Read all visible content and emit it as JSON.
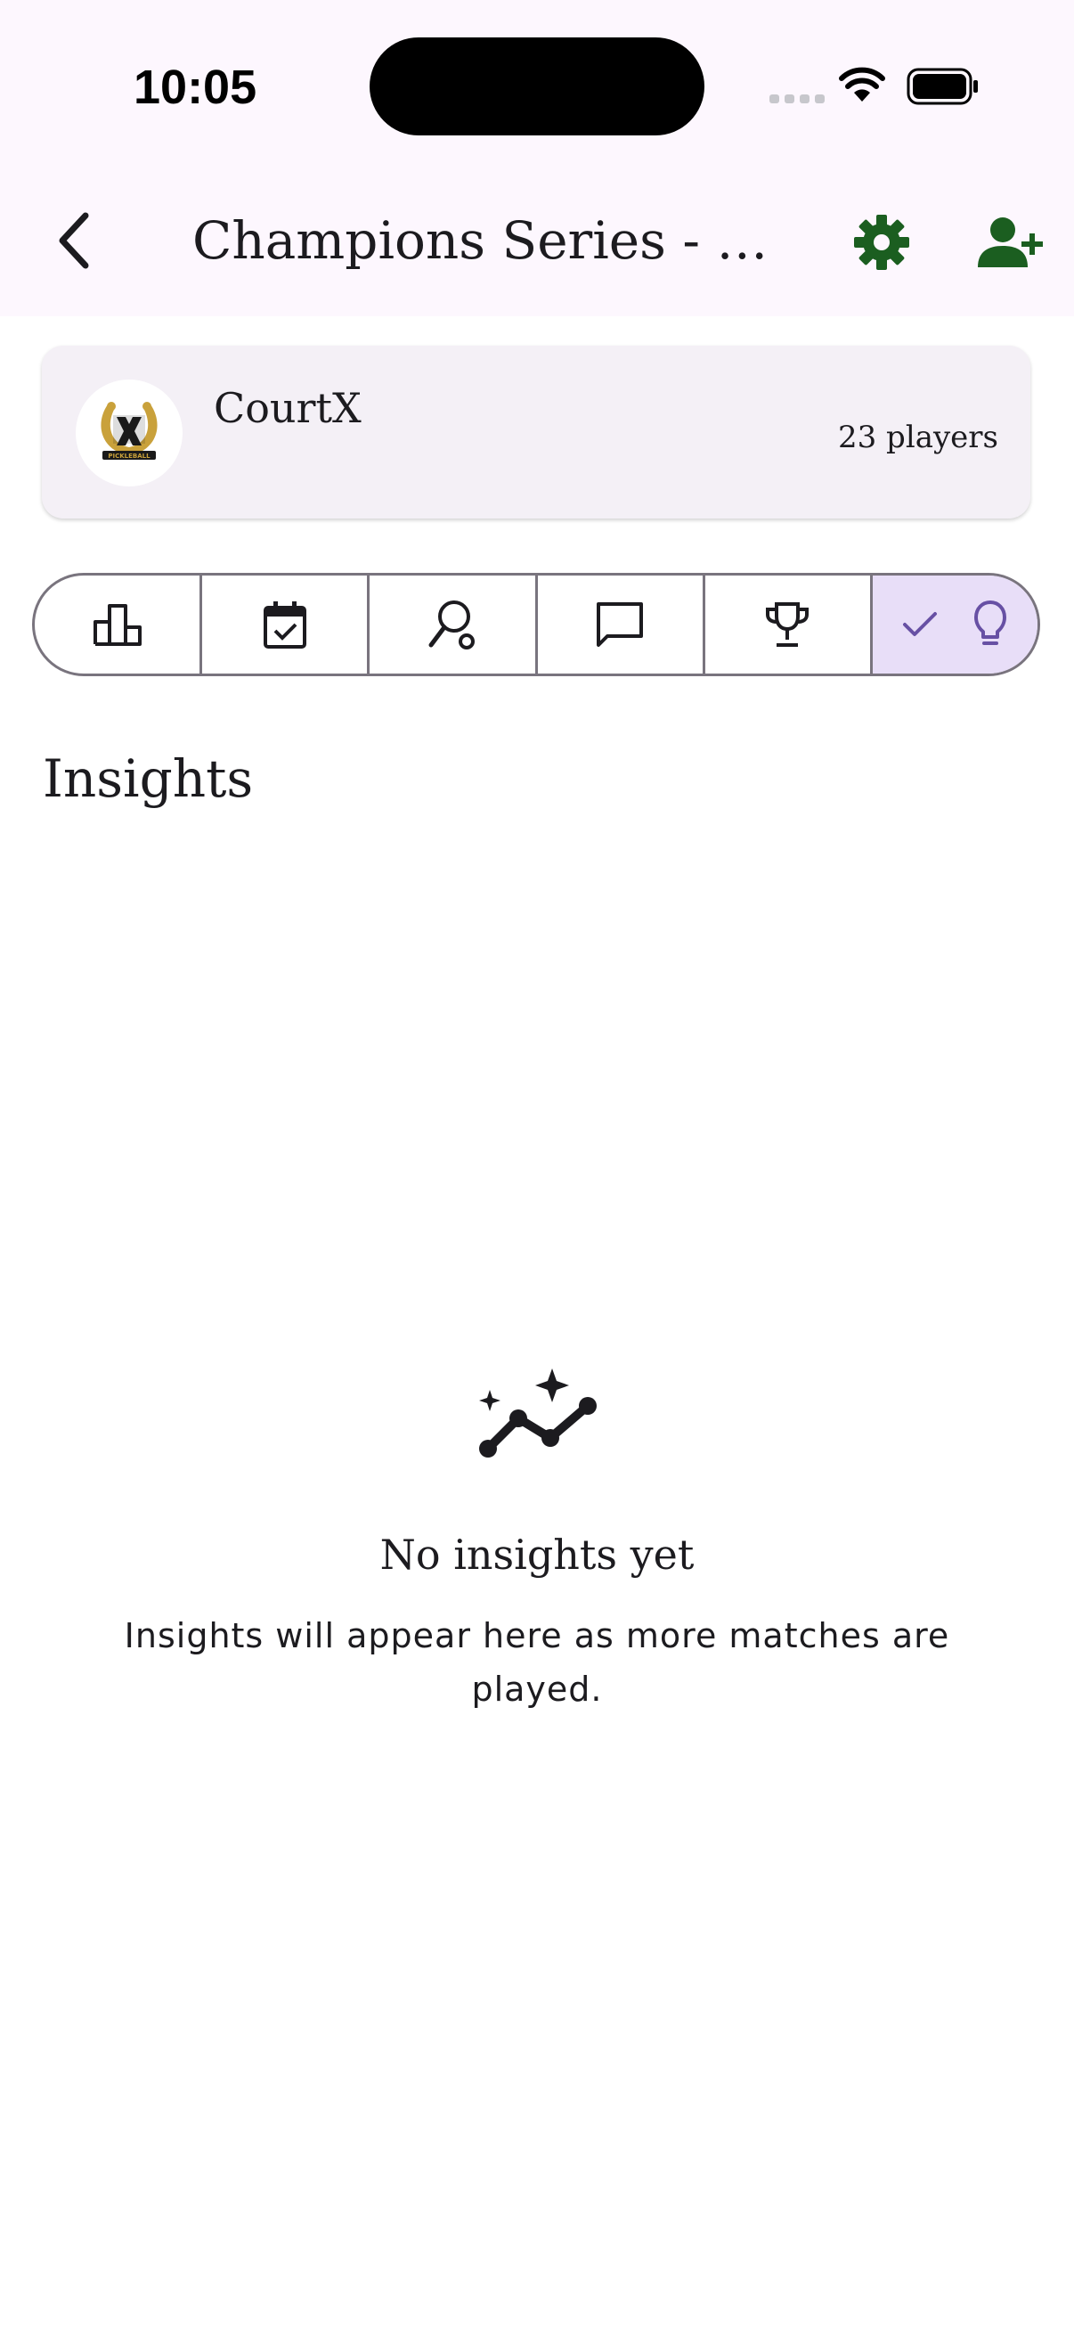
{
  "status_bar": {
    "time": "10:05"
  },
  "header": {
    "title": "Champions Series - Pr..."
  },
  "group": {
    "name": "CourtX",
    "player_count": "23 players",
    "logo_text": "PICKLEBALL"
  },
  "tabs": [
    {
      "icon": "leaderboard-icon",
      "selected": false
    },
    {
      "icon": "calendar-check-icon",
      "selected": false
    },
    {
      "icon": "racket-icon",
      "selected": false
    },
    {
      "icon": "chat-icon",
      "selected": false
    },
    {
      "icon": "trophy-icon",
      "selected": false
    },
    {
      "icon": "lightbulb-icon",
      "selected": true
    }
  ],
  "section": {
    "title": "Insights"
  },
  "empty_state": {
    "title": "No insights yet",
    "description": "Insights will appear here as more matches are played."
  },
  "colors": {
    "accent_green": "#1b5e20",
    "selected_segment": "#e8def8",
    "header_bg": "#fdf7fe"
  }
}
